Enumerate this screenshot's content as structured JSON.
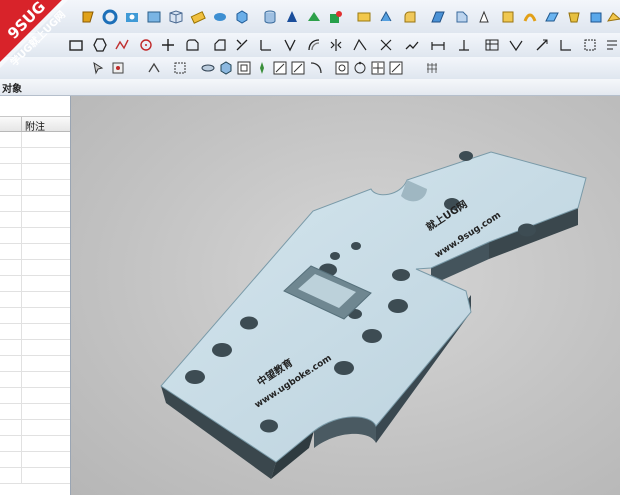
{
  "header": {
    "title": "对象"
  },
  "navigator": {
    "column_note": "附注"
  },
  "watermark": {
    "line1": "9SUG",
    "line2": "学UG就上UG网"
  },
  "part": {
    "label_right_1": "就上UG网",
    "label_right_2": "www.9sug.com",
    "label_left_1": "中望教育",
    "label_left_2": "www.ugboke.com"
  },
  "colors": {
    "part_top": "#c9dde6",
    "part_side": "#3c4a50",
    "logo": "#d8232a",
    "toolbar": "#e6ecf3"
  }
}
